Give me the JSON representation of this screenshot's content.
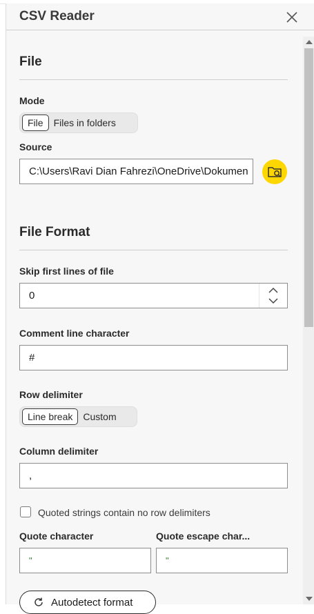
{
  "header": {
    "title": "CSV Reader"
  },
  "file_section": {
    "title": "File",
    "mode_label": "Mode",
    "mode_options": [
      "File",
      "Files in folders"
    ],
    "mode_selected": "File",
    "source_label": "Source",
    "source_value": "C:\\Users\\Ravi Dian Fahrezi\\OneDrive\\Dokumen"
  },
  "format_section": {
    "title": "File Format",
    "skip_label": "Skip first lines of file",
    "skip_value": "0",
    "comment_label": "Comment line character",
    "comment_value": "#",
    "row_delim_label": "Row delimiter",
    "row_delim_options": [
      "Line break",
      "Custom"
    ],
    "row_delim_selected": "Line break",
    "col_delim_label": "Column delimiter",
    "col_delim_value": ",",
    "quoted_checkbox_label": "Quoted strings contain no row delimiters",
    "quoted_checkbox_checked": false,
    "quote_char_label": "Quote character",
    "quote_char_value": "\"",
    "quote_escape_label": "Quote escape char...",
    "quote_escape_value": "\"",
    "autodetect_label": "Autodetect format"
  },
  "colors": {
    "accent": "#ffd700",
    "panel_bg": "#f7f7f7",
    "border": "#8c8c8c"
  },
  "icons": {
    "close": "close-icon",
    "browse": "folder-search-icon",
    "autodetect": "refresh-icon"
  }
}
